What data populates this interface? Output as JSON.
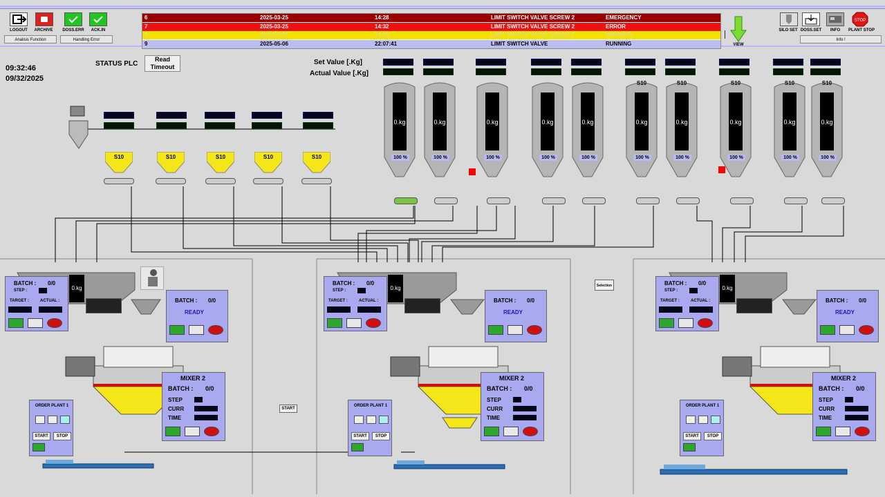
{
  "toolbar": {
    "logout": "LOGOUT",
    "archive": "ARCHIVE",
    "doss_err": "DOSS.ERR",
    "ack_in": "ACK.IN",
    "group1": "Analisis Function",
    "group2": "Handling Error",
    "view": "VIEW",
    "silo_set": "SILO SET",
    "doss_set": "DOSS.SET",
    "info": "INFO",
    "plant_stop": "PLANT STOP",
    "info_group": "Info !"
  },
  "alarms": [
    {
      "id": "6",
      "date": "2025-03-25",
      "time": "14:28",
      "msg": "LIMIT SWITCH VALVE SCREW 2",
      "state": "EMERGENCY",
      "bg": "#9a0000",
      "fg": "#ffffff"
    },
    {
      "id": "7",
      "date": "2025-03-25",
      "time": "14:32",
      "msg": "LIMIT SWITCH VALVE SCREW 2",
      "state": "ERROR",
      "bg": "#ee1111",
      "fg": "#ffffff"
    },
    {
      "id": "8",
      "date": "2025-03-25",
      "time": "14:32",
      "msg": "LIMIT SWITCH VALVE SCREW 2",
      "state": "WARNING",
      "bg": "#f2e200",
      "fg": "#dddd88"
    },
    {
      "id": "9",
      "date": "2025-05-06",
      "time": "22:07:41",
      "msg": "LIMIT SWITCH VALVE",
      "state": "RUNNING",
      "bg": "#bdbdf2",
      "fg": "#000000"
    }
  ],
  "clock": {
    "time": "09:32:46",
    "date": "09/32/2025"
  },
  "status": {
    "label": "STATUS PLC",
    "value_line1": "Read",
    "value_line2": "Timeout"
  },
  "legend": {
    "set_value": "Set Value [.Kg]",
    "actual_value": "Actual Value [.Kg]"
  },
  "silos": [
    {
      "kg": "0.kg",
      "pct": "100 %",
      "tag": ""
    },
    {
      "kg": "0.kg",
      "pct": "100 %",
      "tag": ""
    },
    {
      "kg": "0.kg",
      "pct": "100 %",
      "tag": ""
    },
    {
      "kg": "0.kg",
      "pct": "100 %",
      "tag": ""
    },
    {
      "kg": "0.kg",
      "pct": "100 %",
      "tag": ""
    },
    {
      "kg": "0.kg",
      "pct": "100 %",
      "tag": "S10"
    },
    {
      "kg": "0.kg",
      "pct": "100 %",
      "tag": "S10"
    },
    {
      "kg": "0.kg",
      "pct": "100 %",
      "tag": "S10"
    },
    {
      "kg": "0.kg",
      "pct": "100 %",
      "tag": "S10"
    },
    {
      "kg": "0.kg",
      "pct": "100 %",
      "tag": "S10"
    }
  ],
  "hoppers": [
    {
      "tag": "S10"
    },
    {
      "tag": "S10"
    },
    {
      "tag": "S10"
    },
    {
      "tag": "S10"
    },
    {
      "tag": "S10"
    }
  ],
  "lines": [
    {
      "scale": {
        "batch_label": "BATCH :",
        "batch_val": "0/0",
        "step_label": "STEP :",
        "target_label": "TARGET :",
        "actual_label": "ACTUAL :"
      },
      "weigher": {
        "kg": "0.kg",
        "batch_label": "BATCH :",
        "batch_val": "0/0",
        "status": "READY"
      },
      "mixer": {
        "title": "MIXER 2",
        "batch_label": "BATCH :",
        "batch_val": "0/0",
        "step": "STEP",
        "curr": "CURR",
        "time": "TIME"
      },
      "order": {
        "title": "ORDER PLANT 1",
        "start": "START",
        "stop": "STOP"
      }
    },
    {
      "scale": {
        "batch_label": "BATCH :",
        "batch_val": "0/0",
        "step_label": "STEP :",
        "target_label": "TARGET :",
        "actual_label": "ACTUAL :"
      },
      "weigher": {
        "kg": "0.kg",
        "batch_label": "BATCH :",
        "batch_val": "0/0",
        "status": "READY"
      },
      "mixer": {
        "title": "MIXER 2",
        "batch_label": "BATCH :",
        "batch_val": "0/0",
        "step": "STEP",
        "curr": "CURR",
        "time": "TIME"
      },
      "order": {
        "title": "ORDER PLANT 1",
        "start": "START",
        "stop": "STOP"
      }
    },
    {
      "scale": {
        "batch_label": "BATCH :",
        "batch_val": "0/0",
        "step_label": "STEP :",
        "target_label": "TARGET :",
        "actual_label": "ACTUAL :"
      },
      "weigher": {
        "kg": "0.kg",
        "batch_label": "BATCH :",
        "batch_val": "0/0",
        "status": "READY"
      },
      "mixer": {
        "title": "MIXER 2",
        "batch_label": "BATCH :",
        "batch_val": "0/0",
        "step": "STEP",
        "curr": "CURR",
        "time": "TIME"
      },
      "order": {
        "title": "ORDER PLANT 1",
        "start": "START",
        "stop": "STOP"
      }
    }
  ],
  "misc": {
    "start_small": "START",
    "selection_small": "Selection"
  },
  "colors": {
    "panel": "#a9a9f0",
    "green_button": "#2ea72e",
    "stop_red": "#d01010",
    "hopper_yellow": "#f5e61a",
    "conveyor_blue": "#2a6fb5"
  }
}
